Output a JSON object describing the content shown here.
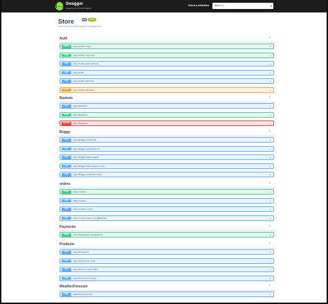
{
  "topbar": {
    "logo_mark": "{…}",
    "logo_text": "Swagger",
    "logo_sub": "supported by SMARTBEAR",
    "definition_label": "Select a definition",
    "definition_value": "Store v1"
  },
  "info": {
    "title": "Store",
    "version": "1.0",
    "oas": "OAS3",
    "spec_link": "https://localhost:5001/swagger/v1/swagger.json"
  },
  "sections": [
    {
      "name": "Auth",
      "operations": [
        {
          "method": "POST",
          "path": "/api/Auth/login"
        },
        {
          "method": "POST",
          "path": "/api/Auth/register"
        },
        {
          "method": "GET",
          "path": "/api/Auth/emailexists"
        },
        {
          "method": "GET",
          "path": "/api/Auth"
        },
        {
          "method": "GET",
          "path": "/api/Auth/address"
        },
        {
          "method": "PUT",
          "path": "/api/Auth/address"
        }
      ]
    },
    {
      "name": "Baskets",
      "operations": [
        {
          "method": "GET",
          "path": "/api/Baskets"
        },
        {
          "method": "POST",
          "path": "/api/Baskets"
        },
        {
          "method": "DELETE",
          "path": "/api/Baskets"
        }
      ]
    },
    {
      "name": "Buggy",
      "operations": [
        {
          "method": "GET",
          "path": "/api/Buggy/notfound"
        },
        {
          "method": "GET",
          "path": "/api/Buggy/servererror"
        },
        {
          "method": "GET",
          "path": "/api/Buggy/badrequest"
        },
        {
          "method": "GET",
          "path": "/api/Buggy/badrequest/{id}"
        },
        {
          "method": "GET",
          "path": "/api/Buggy/unauthorized"
        }
      ]
    },
    {
      "name": "orders",
      "operations": [
        {
          "method": "POST",
          "path": "/api/orders"
        },
        {
          "method": "GET",
          "path": "/api/orders"
        },
        {
          "method": "GET",
          "path": "/api/orders/{id}"
        },
        {
          "method": "GET",
          "path": "/api/orders/deliveryMethods"
        }
      ]
    },
    {
      "name": "Payments",
      "operations": [
        {
          "method": "POST",
          "path": "/api/Payments/{basketId}"
        }
      ]
    },
    {
      "name": "Products",
      "operations": [
        {
          "method": "GET",
          "path": "/api/Products"
        },
        {
          "method": "GET",
          "path": "/api/Products/{id}"
        },
        {
          "method": "GET",
          "path": "/api/Products/brands"
        },
        {
          "method": "GET",
          "path": "/api/Products/types"
        }
      ]
    },
    {
      "name": "WeatherForecast",
      "operations": [
        {
          "method": "GET",
          "path": "/WeatherForecast"
        }
      ]
    }
  ],
  "icons": {
    "expand": "chevron-down-icon",
    "collapse": "chevron-up-icon"
  },
  "colors": {
    "get": "#61affe",
    "post": "#49cc90",
    "put": "#fca130",
    "delete": "#f93e3e",
    "topbar": "#1b1b1b"
  }
}
